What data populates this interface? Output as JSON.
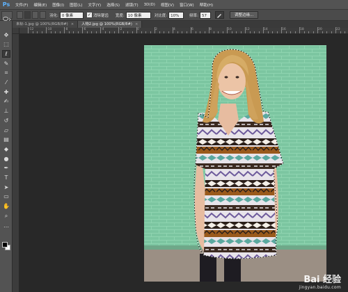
{
  "app": {
    "logo": "Ps"
  },
  "menu": {
    "items": [
      "文件(F)",
      "编辑(E)",
      "图像(I)",
      "图层(L)",
      "文字(Y)",
      "选择(S)",
      "滤镜(T)",
      "3D(D)",
      "视图(V)",
      "窗口(W)",
      "帮助(H)"
    ]
  },
  "options": {
    "feather_label": "羽化:",
    "feather_value": "0 像素",
    "antialias_checked": "✓",
    "antialias_label": "消除锯齿",
    "width_label": "宽度:",
    "width_value": "10 像素",
    "contrast_label": "对比度:",
    "contrast_value": "10%",
    "frequency_label": "频率:",
    "frequency_value": "57",
    "refine_edge_button": "调整边缘..."
  },
  "tabs": [
    {
      "label": "未标-1.jpg @ 100%(RGB/8#)",
      "close": "×"
    },
    {
      "label": "人物2.jpg @ 100%(RGB/8#)",
      "close": "×"
    }
  ],
  "ruler": {
    "ticks": [
      "-12",
      "-10",
      "-8",
      "-6",
      "-4",
      "-2",
      "0",
      "2",
      "4",
      "6",
      "8",
      "10",
      "12",
      "14",
      "16",
      "18",
      "20",
      "22"
    ]
  },
  "tools": [
    {
      "icon": "move-icon",
      "glyph": "✥"
    },
    {
      "icon": "marquee-icon",
      "glyph": "⬚"
    },
    {
      "icon": "magnetic-lasso-icon",
      "glyph": "ℓ"
    },
    {
      "icon": "quick-select-icon",
      "glyph": "✎"
    },
    {
      "icon": "crop-icon",
      "glyph": "⌗"
    },
    {
      "icon": "eyedropper-icon",
      "glyph": "⁄"
    },
    {
      "icon": "healing-icon",
      "glyph": "✚"
    },
    {
      "icon": "brush-icon",
      "glyph": "✍"
    },
    {
      "icon": "stamp-icon",
      "glyph": "⊥"
    },
    {
      "icon": "history-brush-icon",
      "glyph": "↺"
    },
    {
      "icon": "eraser-icon",
      "glyph": "▱"
    },
    {
      "icon": "gradient-icon",
      "glyph": "▤"
    },
    {
      "icon": "blur-icon",
      "glyph": "◆"
    },
    {
      "icon": "dodge-icon",
      "glyph": "●"
    },
    {
      "icon": "pen-icon",
      "glyph": "✒"
    },
    {
      "icon": "type-icon",
      "glyph": "T"
    },
    {
      "icon": "path-select-icon",
      "glyph": "➤"
    },
    {
      "icon": "shape-icon",
      "glyph": "▭"
    },
    {
      "icon": "hand-icon",
      "glyph": "✋"
    },
    {
      "icon": "zoom-icon",
      "glyph": "⌕"
    },
    {
      "icon": "more-icon",
      "glyph": "…"
    }
  ],
  "watermark": {
    "logo": "Bai 经验",
    "url": "jingyan.baidu.com"
  },
  "colors": {
    "wall": "#7cc6a1",
    "annotation_arrow": "#e02020"
  }
}
